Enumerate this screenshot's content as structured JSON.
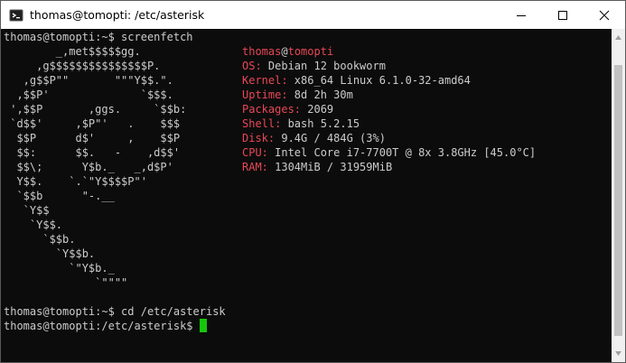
{
  "window": {
    "title": "thomas@tomopti: /etc/asterisk"
  },
  "terminal": {
    "prompt1": "thomas@tomopti:~$ screenfetch",
    "logo": [
      "        _,met$$$$$gg.",
      "     ,g$$$$$$$$$$$$$$$P.",
      "   ,g$$P\"\"       \"\"\"Y$$.\".",
      "  ,$$P'              `$$$.",
      " ',$$P       ,ggs.     `$$b:",
      " `d$$'     ,$P\"'   .    $$$",
      "  $$P      d$'     ,    $$P",
      "  $$:      $$.   -    ,d$$'",
      "  $$\\;      Y$b._   _,d$P'",
      "  Y$$.    `.`\"Y$$$$P\"'",
      "  `$$b      \"-.__",
      "   `Y$$",
      "    `Y$$.",
      "      `$$b.",
      "        `Y$$b.",
      "          `\"Y$b._",
      "              `\"\"\"\""
    ],
    "user": "thomas",
    "at": "@",
    "host": "tomopti",
    "info": [
      {
        "label": "OS:",
        "value": " Debian 12 bookworm"
      },
      {
        "label": "Kernel:",
        "value": " x86_64 Linux 6.1.0-32-amd64"
      },
      {
        "label": "Uptime:",
        "value": " 8d 2h 30m"
      },
      {
        "label": "Packages:",
        "value": " 2069"
      },
      {
        "label": "Shell:",
        "value": " bash 5.2.15"
      },
      {
        "label": "Disk:",
        "value": " 9.4G / 484G (3%)"
      },
      {
        "label": "CPU:",
        "value": " Intel Core i7-7700T @ 8x 3.8GHz [45.0°C]"
      },
      {
        "label": "RAM:",
        "value": " 1304MiB / 31959MiB"
      }
    ],
    "prompt2": "thomas@tomopti:~$ cd /etc/asterisk",
    "prompt3": "thomas@tomopti:/etc/asterisk$ "
  },
  "colors": {
    "accent_red": "#e74856",
    "cursor_green": "#16c60c",
    "text": "#cccccc",
    "background": "#0c0c0c"
  }
}
